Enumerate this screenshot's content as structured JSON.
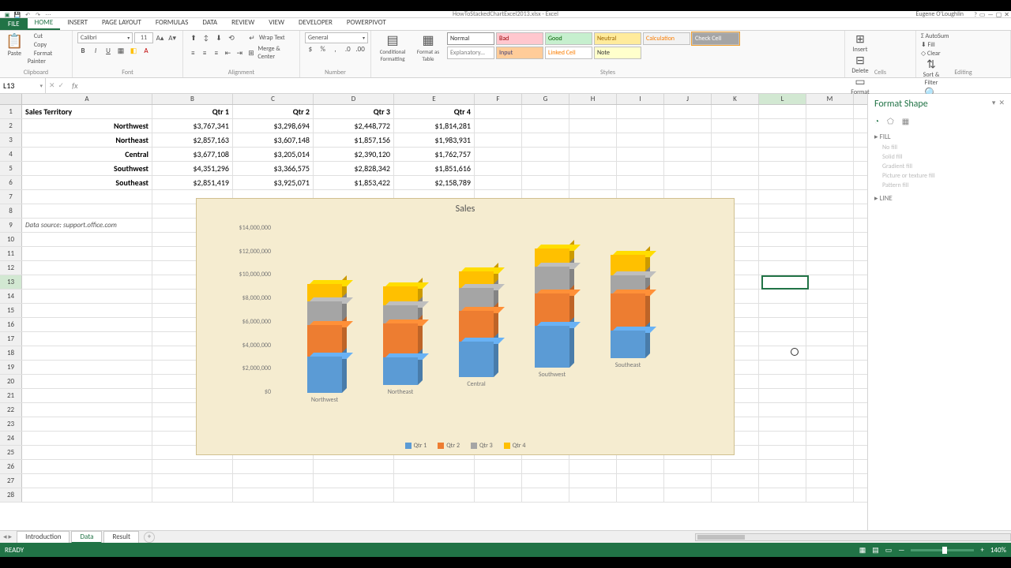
{
  "title": "HowToStackedChartExcel2013.xlsx - Excel",
  "user": "Eugene O'Loughlin",
  "tabs": {
    "file": "FILE",
    "items": [
      "HOME",
      "INSERT",
      "PAGE LAYOUT",
      "FORMULAS",
      "DATA",
      "REVIEW",
      "VIEW",
      "DEVELOPER",
      "POWERPIVOT"
    ],
    "active": 0
  },
  "ribbon": {
    "clipboard": {
      "paste": "Paste",
      "cut": "Cut",
      "copy": "Copy",
      "fp": "Format Painter",
      "label": "Clipboard"
    },
    "font": {
      "name": "Calibri",
      "size": "11",
      "label": "Font"
    },
    "alignment": {
      "wrap": "Wrap Text",
      "merge": "Merge & Center",
      "label": "Alignment"
    },
    "number": {
      "fmt": "General",
      "label": "Number"
    },
    "styles": {
      "cond": "Conditional Formatting",
      "fat": "Format as Table",
      "boxes": [
        {
          "t": "Normal",
          "bg": "#ffffff",
          "fg": "#333",
          "bd": "#999"
        },
        {
          "t": "Bad",
          "bg": "#ffc7ce",
          "fg": "#9c0006"
        },
        {
          "t": "Good",
          "bg": "#c6efce",
          "fg": "#006100"
        },
        {
          "t": "Neutral",
          "bg": "#ffeb9c",
          "fg": "#9c6500"
        },
        {
          "t": "Calculation",
          "bg": "#f2f2f2",
          "fg": "#fa7d00"
        },
        {
          "t": "Check Cell",
          "bg": "#a5a5a5",
          "fg": "#fff"
        },
        {
          "t": "Explanatory...",
          "bg": "#fff",
          "fg": "#7f7f7f"
        },
        {
          "t": "Input",
          "bg": "#ffcc99",
          "fg": "#3f3f76"
        },
        {
          "t": "Linked Cell",
          "bg": "#fff",
          "fg": "#fa7d00"
        },
        {
          "t": "Note",
          "bg": "#ffffcc",
          "fg": "#333"
        }
      ],
      "label": "Styles"
    },
    "cells": {
      "insert": "Insert",
      "delete": "Delete",
      "format": "Format",
      "label": "Cells"
    },
    "editing": {
      "autosum": "AutoSum",
      "fill": "Fill",
      "clear": "Clear",
      "sort": "Sort & Filter",
      "find": "Find & Select",
      "label": "Editing"
    }
  },
  "namebox": "L13",
  "columns": [
    "A",
    "B",
    "C",
    "D",
    "E",
    "F",
    "G",
    "H",
    "I",
    "J",
    "K",
    "L",
    "M"
  ],
  "selectedCol": "L",
  "selectedRow": 13,
  "table": {
    "header": [
      "Sales Territory",
      "Qtr 1",
      "Qtr 2",
      "Qtr 3",
      "Qtr 4"
    ],
    "rows": [
      [
        "Northwest",
        "$3,767,341",
        "$3,298,694",
        "$2,448,772",
        "$1,814,281"
      ],
      [
        "Northeast",
        "$2,857,163",
        "$3,607,148",
        "$1,857,156",
        "$1,983,931"
      ],
      [
        "Central",
        "$3,677,108",
        "$3,205,014",
        "$2,390,120",
        "$1,762,757"
      ],
      [
        "Southwest",
        "$4,351,296",
        "$3,366,575",
        "$2,828,342",
        "$1,851,616"
      ],
      [
        "Southeast",
        "$2,851,419",
        "$3,925,071",
        "$1,853,422",
        "$2,158,789"
      ]
    ],
    "source": "Data source: support.office.com"
  },
  "chart_data": {
    "type": "bar",
    "title": "Sales",
    "categories": [
      "Northwest",
      "Northeast",
      "Central",
      "Southwest",
      "Southeast"
    ],
    "series": [
      {
        "name": "Qtr 1",
        "color": "#5b9bd5",
        "values": [
          3767341,
          2857163,
          3677108,
          4351296,
          2851419
        ]
      },
      {
        "name": "Qtr 2",
        "color": "#ed7d31",
        "values": [
          3298694,
          3607148,
          3205014,
          3366575,
          3925071
        ]
      },
      {
        "name": "Qtr 3",
        "color": "#a5a5a5",
        "values": [
          2448772,
          1857156,
          2390120,
          2828342,
          1853422
        ]
      },
      {
        "name": "Qtr 4",
        "color": "#ffc000",
        "values": [
          1814281,
          1983931,
          1762757,
          1851616,
          2158789
        ]
      }
    ],
    "ylim": [
      0,
      14000000
    ],
    "yticks": [
      "$0",
      "$2,000,000",
      "$4,000,000",
      "$6,000,000",
      "$8,000,000",
      "$10,000,000",
      "$12,000,000",
      "$14,000,000"
    ]
  },
  "panel": {
    "title": "Format Shape",
    "sections": {
      "fill": "FILL",
      "line": "LINE"
    },
    "fillopts": [
      "No fill",
      "Solid fill",
      "Gradient fill",
      "Picture or texture fill",
      "Pattern fill"
    ]
  },
  "sheets": {
    "items": [
      "Introduction",
      "Data",
      "Result"
    ],
    "active": 1
  },
  "status": {
    "ready": "READY",
    "zoom": "140%"
  }
}
